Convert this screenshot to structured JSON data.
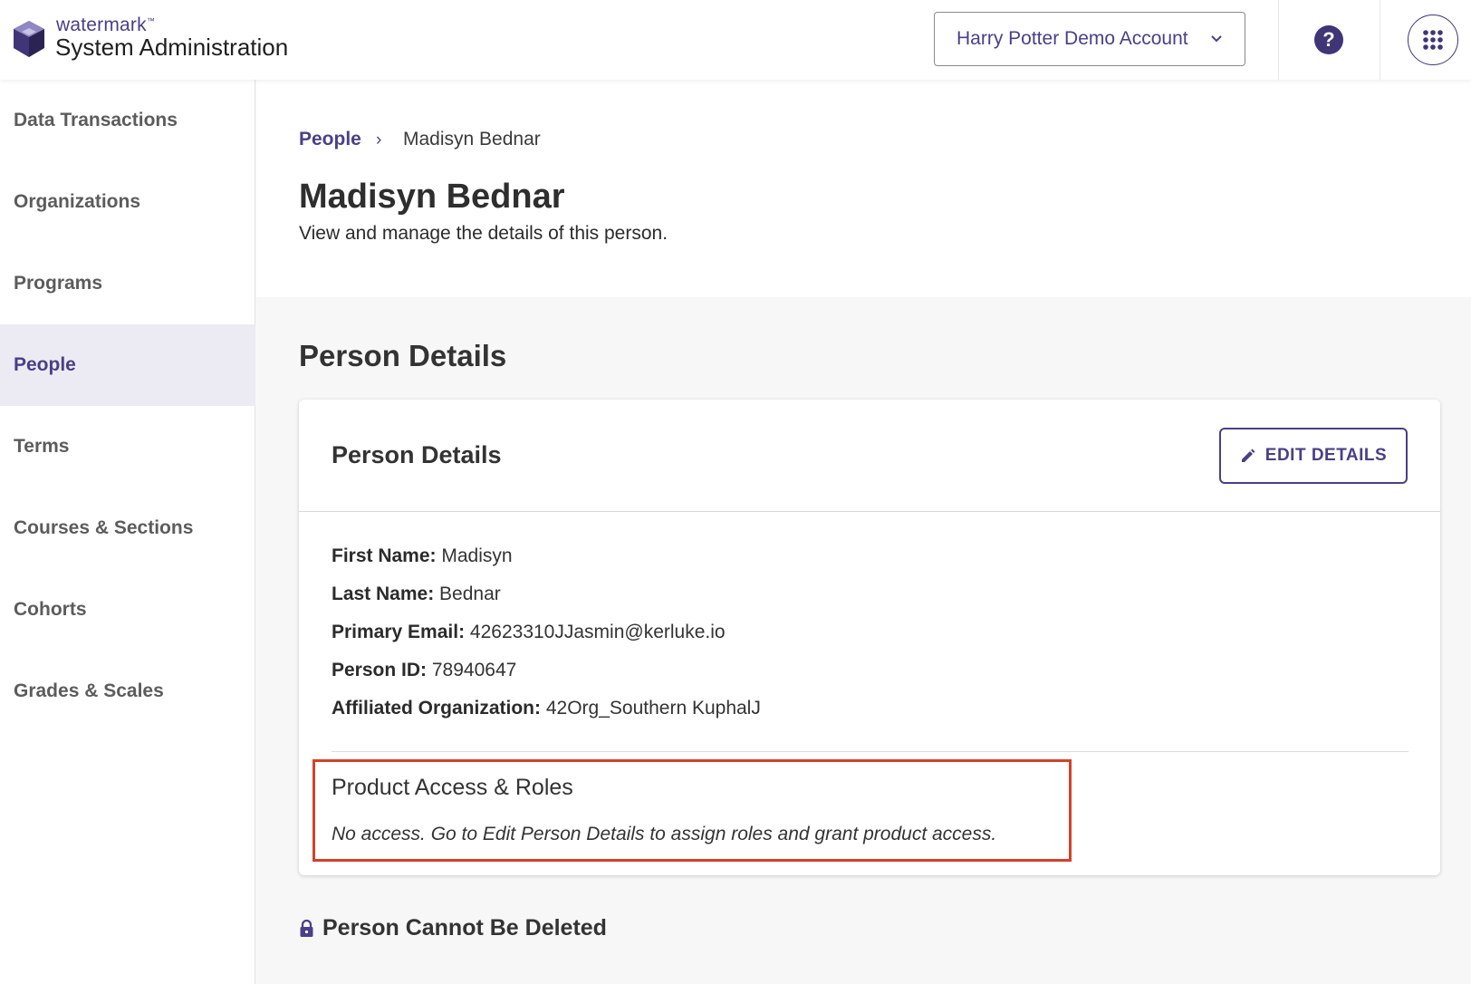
{
  "header": {
    "brand": "watermark",
    "brand_tm": "™",
    "product": "System Administration",
    "account_selector": "Harry Potter Demo Account",
    "help_label": "?"
  },
  "sidebar": {
    "items": [
      {
        "label": "Data Transactions",
        "active": false
      },
      {
        "label": "Organizations",
        "active": false
      },
      {
        "label": "Programs",
        "active": false
      },
      {
        "label": "People",
        "active": true
      },
      {
        "label": "Terms",
        "active": false
      },
      {
        "label": "Courses & Sections",
        "active": false
      },
      {
        "label": "Cohorts",
        "active": false
      },
      {
        "label": "Grades & Scales",
        "active": false
      }
    ]
  },
  "breadcrumb": {
    "parent": "People",
    "separator": "›",
    "current": "Madisyn Bednar"
  },
  "page": {
    "title": "Madisyn Bednar",
    "subtitle": "View and manage the details of this person."
  },
  "section": {
    "heading": "Person Details",
    "card": {
      "title": "Person Details",
      "edit_button": "EDIT DETAILS",
      "fields": [
        {
          "label": "First Name:",
          "value": "Madisyn"
        },
        {
          "label": "Last Name:",
          "value": "Bednar"
        },
        {
          "label": "Primary Email:",
          "value": "42623310JJasmin@kerluke.io"
        },
        {
          "label": "Person ID:",
          "value": "78940647"
        },
        {
          "label": "Affiliated Organization:",
          "value": "42Org_Southern KuphalJ"
        }
      ],
      "product_access": {
        "title": "Product Access & Roles",
        "note": "No access. Go to Edit Person Details to assign roles and grant product access."
      }
    }
  },
  "delete_notice": "Person Cannot Be Deleted",
  "colors": {
    "brand": "#4b3f86",
    "highlight": "#d3412a",
    "active_nav_bg": "#ecebf3"
  },
  "icons": {
    "logo": "watermark-logo-icon",
    "account_chevron": "chevron-down-icon",
    "help": "help-icon",
    "apps": "apps-grid-icon",
    "edit": "pencil-icon",
    "lock": "lock-icon"
  }
}
